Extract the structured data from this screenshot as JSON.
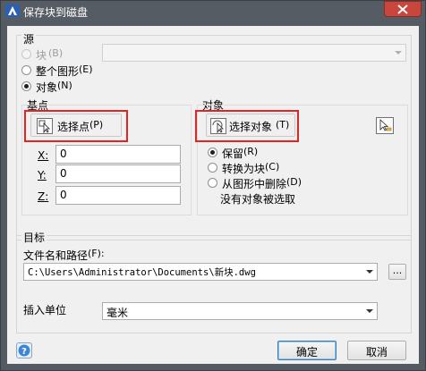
{
  "window": {
    "title": "保存块到磁盘"
  },
  "source": {
    "group_title": "源",
    "block_label": "块",
    "block_key": "(B)",
    "entire_drawing_label": "整个图形",
    "entire_drawing_key": "(E)",
    "objects_label": "对象",
    "objects_key": "(N)",
    "selected": "objects"
  },
  "basepoint": {
    "group_title": "基点",
    "pick_point_label": "选择点",
    "pick_point_key": "(P)",
    "x_label": "X:",
    "y_label": "Y:",
    "z_label": "Z:",
    "x_value": "0",
    "y_value": "0",
    "z_value": "0"
  },
  "objects": {
    "group_title": "对象",
    "select_objects_label": "选择对象",
    "select_objects_key": "(T)",
    "retain_label": "保留",
    "retain_key": "(R)",
    "convert_label": "转换为块",
    "convert_key": "(C)",
    "delete_label": "从图形中删除",
    "delete_key": "(D)",
    "selected": "retain",
    "status": "没有对象被选取"
  },
  "destination": {
    "group_title": "目标",
    "path_label": "文件名和路径",
    "path_key": "(F):",
    "path_value": "C:\\Users\\Administrator\\Documents\\新块.dwg",
    "browse_label": "...",
    "units_label": "插入单位",
    "units_value": "毫米"
  },
  "footer": {
    "ok_label": "确定",
    "cancel_label": "取消"
  },
  "colors": {
    "highlight": "#e12424",
    "titlebar": "#555c64",
    "close": "#c9463d"
  }
}
